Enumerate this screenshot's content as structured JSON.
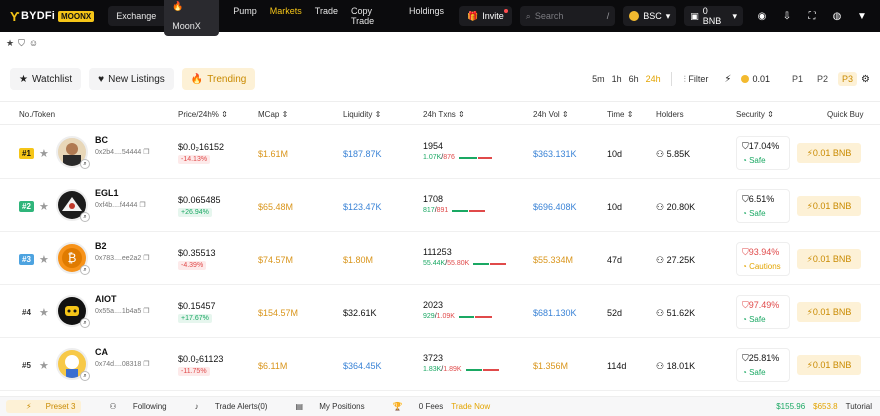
{
  "nav": {
    "logo_mark": "Ƴ",
    "logo_text": "BYDFi",
    "logo_moonx": "MOONX",
    "exchange": "Exchange",
    "moonx": "🔥MoonX",
    "links": [
      "Pump",
      "Markets",
      "Trade",
      "Copy Trade",
      "Holdings"
    ],
    "invite": "Invite",
    "search_placeholder": "Search",
    "search_shortcut": "/",
    "chain": "BSC",
    "wallet": "0 BNB"
  },
  "filters": {
    "tabs": [
      "Watchlist",
      "New Listings",
      "Trending"
    ],
    "timeframes": [
      "5m",
      "1h",
      "6h",
      "24h"
    ],
    "filter_label": "Filter",
    "amount": "0.01",
    "presets": [
      "P1",
      "P2",
      "P3"
    ]
  },
  "table": {
    "headers": [
      "No./Token",
      "Price/24h% ⇕",
      "MCap ⇕",
      "Liquidity ⇕",
      "24h Txns ⇕",
      "24h Vol ⇕",
      "Time ⇕",
      "Holders",
      "Security ⇕",
      "Quick Buy"
    ],
    "quick_buy": "⚡0.01 BNB",
    "rows": [
      {
        "rank": "#1",
        "name": "BC",
        "addr": "0x2b4....54444",
        "price": "$0.0₂16152",
        "change": "-14.13%",
        "mcap": "$1.61M",
        "liq": "$187.87K",
        "txns": "1954",
        "buys": "1.07K",
        "sells": "876",
        "vol": "$363.131K",
        "time": "10d",
        "holders": "5.85K",
        "sec": "17.04%",
        "sec_status": "Safe"
      },
      {
        "rank": "#2",
        "name": "EGL1",
        "addr": "0xf4b....f4444",
        "price": "$0.065485",
        "change": "+26.94%",
        "mcap": "$65.48M",
        "liq": "$123.47K",
        "txns": "1708",
        "buys": "817",
        "sells": "891",
        "vol": "$696.408K",
        "time": "10d",
        "holders": "20.80K",
        "sec": "6.51%",
        "sec_status": "Safe"
      },
      {
        "rank": "#3",
        "name": "B2",
        "addr": "0x783....ee2a2",
        "price": "$0.35513",
        "change": "-4.39%",
        "mcap": "$74.57M",
        "liq": "$1.80M",
        "txns": "111253",
        "buys": "55.44K",
        "sells": "55.80K",
        "vol": "$55.334M",
        "time": "47d",
        "holders": "27.25K",
        "sec": "93.94%",
        "sec_status": "Cautions"
      },
      {
        "rank": "#4",
        "name": "AIOT",
        "addr": "0x55a....1b4a5",
        "price": "$0.15457",
        "change": "+17.67%",
        "mcap": "$154.57M",
        "liq": "$32.61K",
        "txns": "2023",
        "buys": "929",
        "sells": "1.09K",
        "vol": "$681.130K",
        "time": "52d",
        "holders": "51.62K",
        "sec": "97.49%",
        "sec_status": "Safe"
      },
      {
        "rank": "#5",
        "name": "CA",
        "addr": "0x74d....08318",
        "price": "$0.0₂61123",
        "change": "-11.75%",
        "mcap": "$6.11M",
        "liq": "$364.45K",
        "txns": "3723",
        "buys": "1.83K",
        "sells": "1.89K",
        "vol": "$1.356M",
        "time": "114d",
        "holders": "18.01K",
        "sec": "25.81%",
        "sec_status": "Safe"
      }
    ]
  },
  "bottom": {
    "preset": "Preset 3",
    "following": "Following",
    "alerts": "Trade Alerts(0)",
    "positions": "My Positions",
    "fees": "0 Fees",
    "trade_now": "Trade Now",
    "price1": "$155.96",
    "price2": "$653.8",
    "tutorial": "Tutorial"
  },
  "colors": {
    "accent": "#f5c518",
    "positive": "#1aa863",
    "negative": "#e04a4a",
    "link_blue": "#3a83d6"
  }
}
